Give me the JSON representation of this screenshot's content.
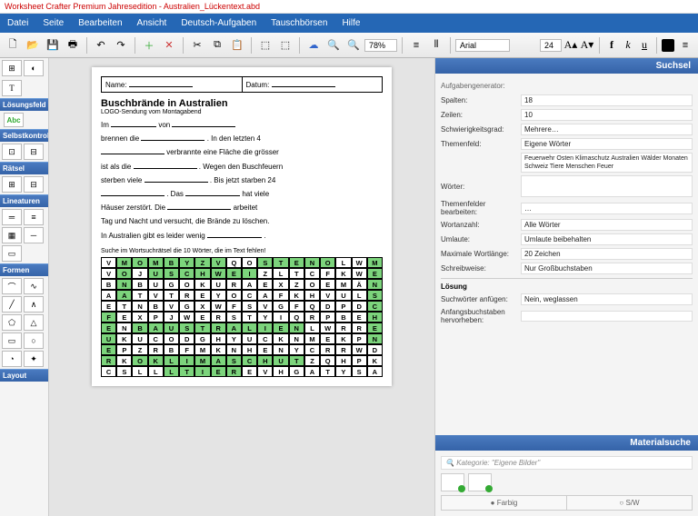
{
  "title": "Worksheet Crafter Premium Jahresedition - Australien_Lückentext.abd",
  "menu": {
    "datei": "Datei",
    "seite": "Seite",
    "bearbeiten": "Bearbeiten",
    "ansicht": "Ansicht",
    "deutsch": "Deutsch-Aufgaben",
    "tausch": "Tauschbörsen",
    "hilfe": "Hilfe"
  },
  "toolbar": {
    "zoom": "78%",
    "font": "Arial",
    "size": "24"
  },
  "sidebar": {
    "losung": "Lösungsfeld",
    "abc": "Abc",
    "selbst": "Selbstkontrolle",
    "raetsel": "Rätsel",
    "lineaturen": "Lineaturen",
    "formen": "Formen",
    "layout": "Layout"
  },
  "worksheet": {
    "name_lbl": "Name:",
    "date_lbl": "Datum:",
    "heading": "Buschbrände in Australien",
    "sub": "LOGO-Sendung vom Montagabend",
    "t1": "Im ",
    "t2": " von ",
    "t3": "brennen die ",
    "t4": " . In den letzten 4",
    "t5": " verbrannte eine Fläche die grösser",
    "t6": "ist als die ",
    "t7": " . Wegen den Buschfeuern",
    "t8": "sterben viele ",
    "t9": " . Bis jetzt starben 24",
    "t10": " . Das ",
    "t11": " hat viele",
    "t12": "Häuser zerstört. Die ",
    "t13": " arbeitet",
    "t14": "Tag und Nacht und versucht, die Brände zu löschen.",
    "t15": "In Australien gibt es leider wenig ",
    "t16": " .",
    "instr": "Suche im Wortsuchrätsel die 10 Wörter, die im Text fehlen!"
  },
  "wordsearch": {
    "cols": 18,
    "grid": [
      "VMOMBYZVQOSTENOLWM",
      "VOJUSCHWEIZLTCFKWE",
      "BNBUGOKURAEXZOEMÄN",
      "AATVTREYOCAFKHVULS",
      "ETNBVGXWFSVGFQDPDC",
      "FEXPJWERSTYIQRPBEH",
      "ENBAUSTRALIENLWRRE",
      "UKUCODGHYUCKNMEKPN",
      "EPZRBFMKNHENYCRRWD",
      "RKOKLIMASCHUTZQHPK",
      "CSLLLTIEREVHGATYSA"
    ],
    "hl": [
      [
        1,
        2,
        3,
        4,
        5,
        6,
        7
      ],
      [
        1
      ],
      [
        1,
        13,
        14,
        15,
        16,
        17
      ],
      [
        1
      ],
      [
        1,
        2,
        9,
        10,
        11,
        12,
        13,
        14,
        17
      ],
      [
        1,
        2,
        17
      ],
      [
        1,
        2,
        17
      ],
      [
        4,
        5,
        6,
        7,
        8,
        9,
        10,
        11,
        12,
        13,
        17
      ],
      [
        1,
        2,
        3,
        4,
        5,
        6,
        7,
        8,
        9
      ],
      [
        0,
        17
      ],
      [
        0,
        2,
        3,
        4,
        5,
        6,
        7,
        8,
        9,
        10,
        11,
        12,
        13,
        17
      ],
      [
        0,
        1,
        2,
        4,
        5,
        6,
        7,
        8
      ]
    ]
  },
  "suchsel": {
    "hdr": "Suchsel",
    "gen": "Aufgabengenerator:",
    "spalten_l": "Spalten:",
    "spalten_v": "18",
    "zeilen_l": "Zeilen:",
    "zeilen_v": "10",
    "schwierig_l": "Schwierigkeitsgrad:",
    "schwierig_v": "Mehrere…",
    "themen_l": "Themenfeld:",
    "themen_v": "Eigene Wörter",
    "worter_l": "Wörter:",
    "worter_v": "Feuerwehr Osten Klimaschutz Australien Wälder  Monaten Schweiz Tiere Menschen Feuer",
    "tfb_l": "Themenfelder bearbeiten:",
    "tfb_v": "…",
    "wortanz_l": "Wortanzahl:",
    "wortanz_v": "Alle Wörter",
    "umlaut_l": "Umlaute:",
    "umlaut_v": "Umlaute beibehalten",
    "maxlen_l": "Maximale Wortlänge:",
    "maxlen_v": "20 Zeichen",
    "schreib_l": "Schreibweise:",
    "schreib_v": "Nur Großbuchstaben",
    "losung": "Lösung",
    "suchw_l": "Suchwörter anfügen:",
    "suchw_v": "Nein, weglassen",
    "anfang_l": "Anfangsbuchstaben hervorheben:"
  },
  "material": {
    "hdr": "Materialsuche",
    "cat_pre": "Kategorie: ",
    "cat": "\"Eigene Bilder\"",
    "farbig": "Farbig",
    "sw": "S/W"
  }
}
